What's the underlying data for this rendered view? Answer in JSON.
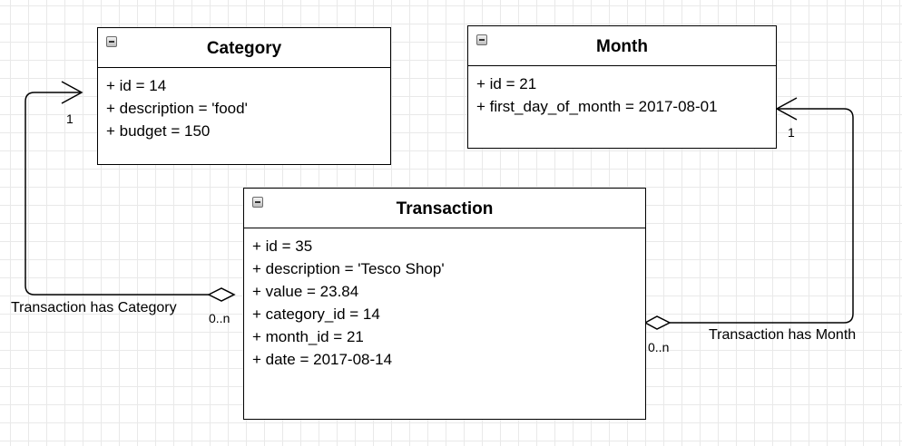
{
  "classes": {
    "category": {
      "name": "Category",
      "attributes": [
        "+ id = 14",
        "+ description = 'food'",
        "+ budget = 150"
      ]
    },
    "month": {
      "name": "Month",
      "attributes": [
        "+ id = 21",
        "+ first_day_of_month = 2017-08-01"
      ]
    },
    "transaction": {
      "name": "Transaction",
      "attributes": [
        "+ id = 35",
        "+ description = 'Tesco Shop'",
        "+ value = 23.84",
        "+ category_id = 14",
        "+ month_id = 21",
        "+ date = 2017-08-14"
      ]
    }
  },
  "associations": {
    "transaction_category": {
      "name": "Transaction has Category",
      "source_multiplicity": "0..n",
      "target_multiplicity": "1"
    },
    "transaction_month": {
      "name": "Transaction has Month",
      "source_multiplicity": "0..n",
      "target_multiplicity": "1"
    }
  },
  "colors": {
    "line": "#000000",
    "grid": "#e9e9e9",
    "background": "#ffffff"
  }
}
